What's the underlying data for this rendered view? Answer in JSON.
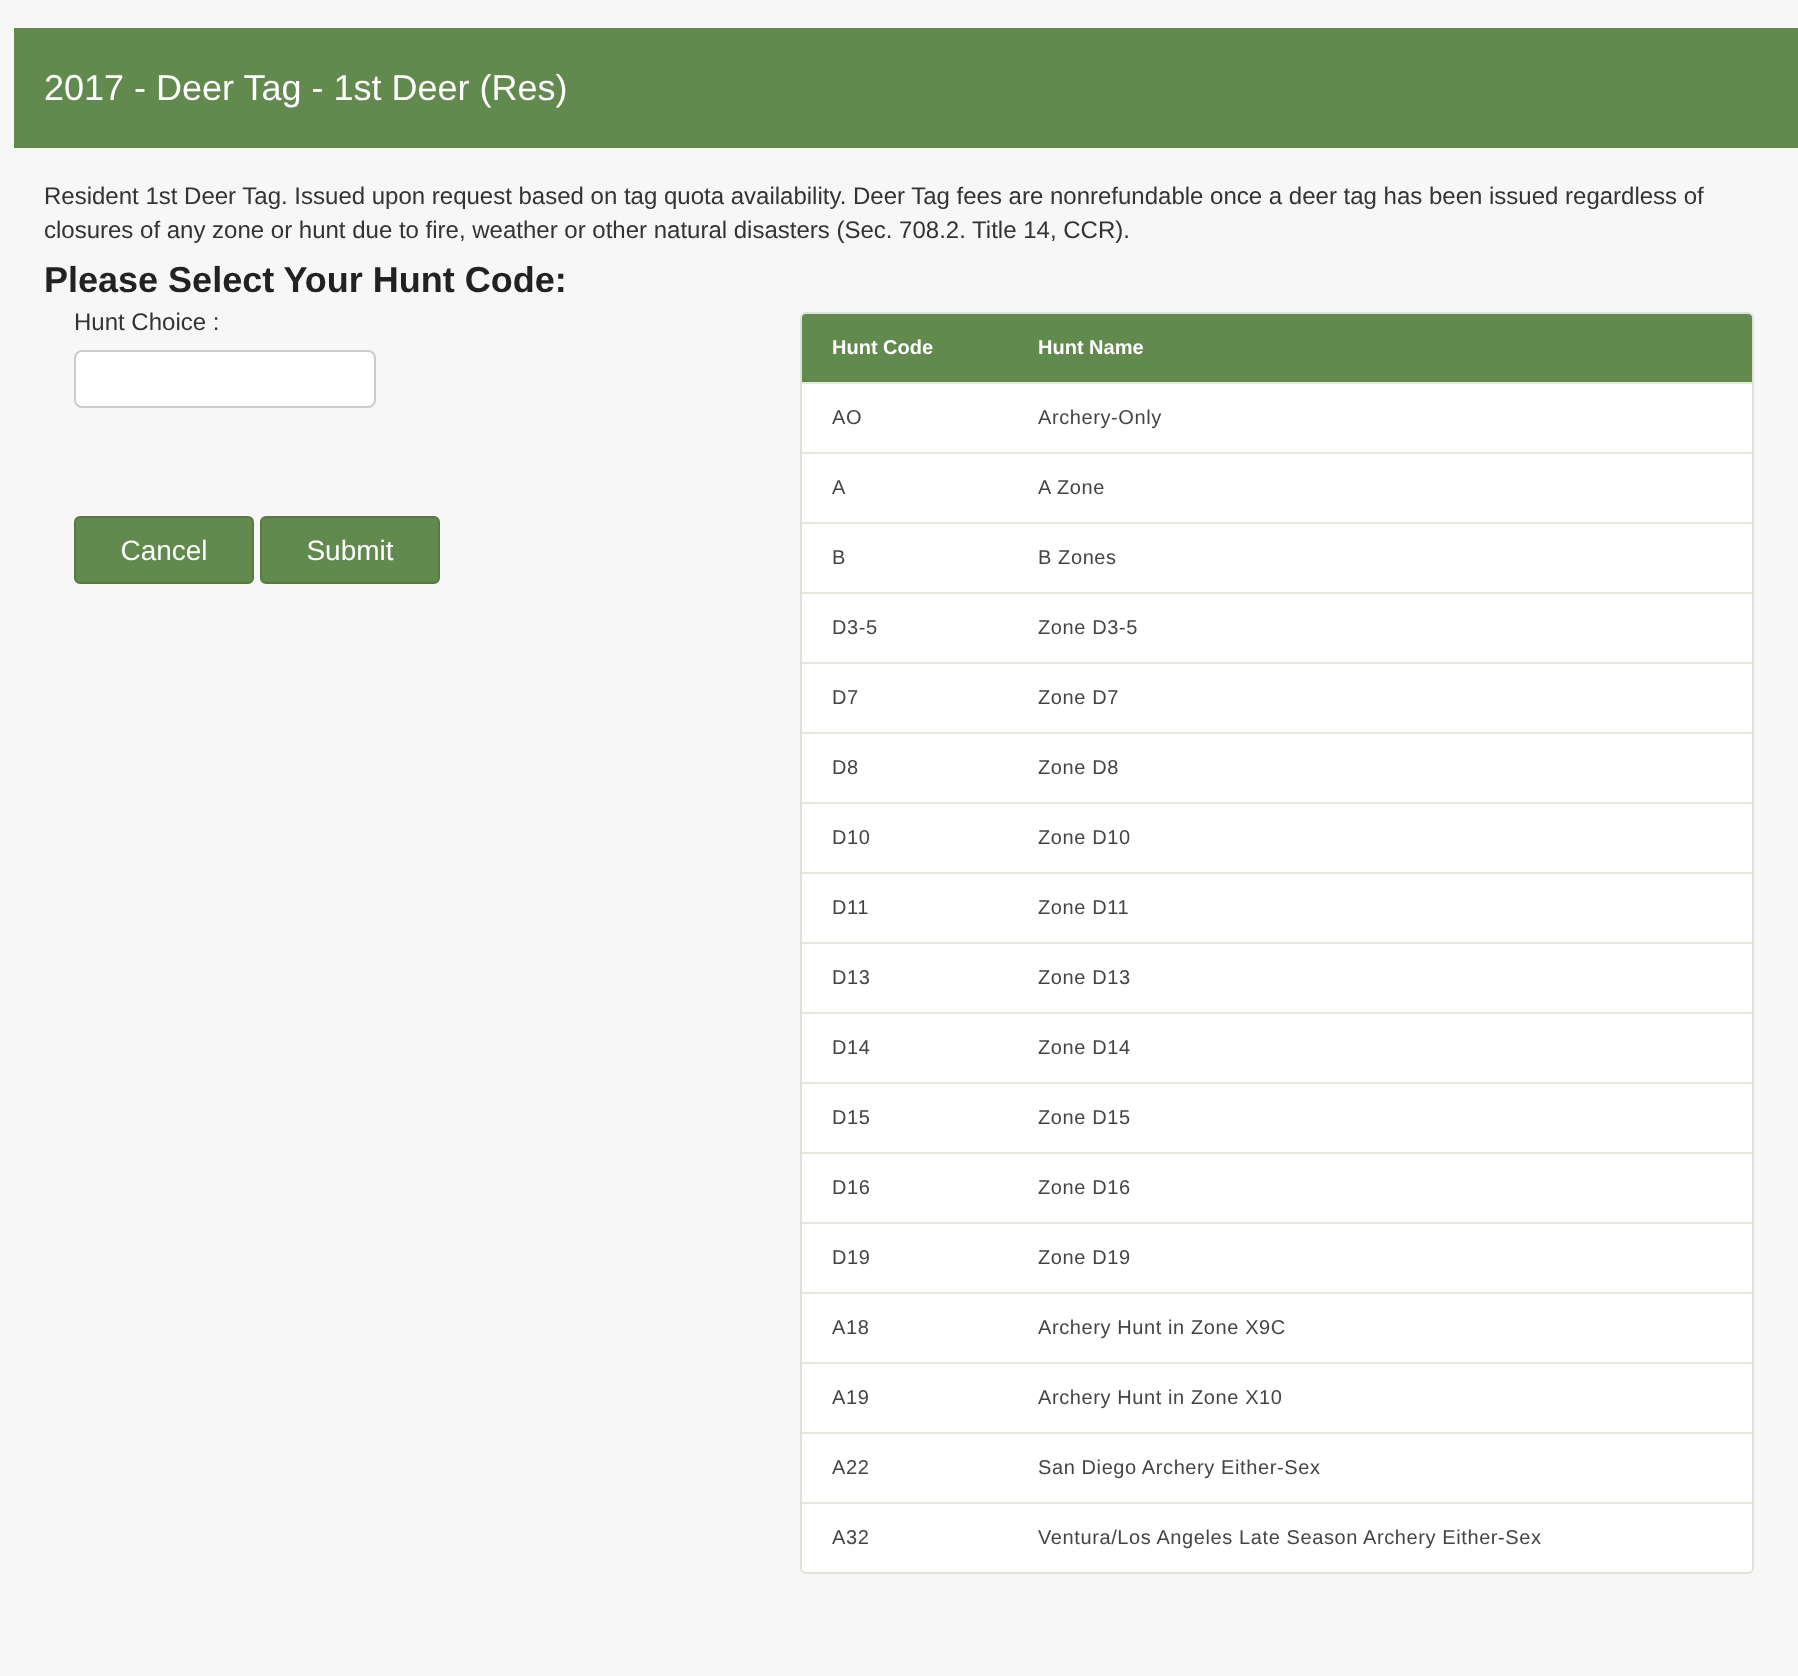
{
  "header": {
    "title": "2017 - Deer Tag - 1st Deer (Res)"
  },
  "description": "Resident 1st Deer Tag. Issued upon request based on tag quota availability. Deer Tag fees are nonrefundable once a deer tag has been issued regardless of closures of any zone or hunt due to fire, weather or other natural disasters (Sec. 708.2. Title 14, CCR).",
  "heading": "Please Select Your Hunt Code:",
  "field": {
    "label": "Hunt Choice :"
  },
  "buttons": [
    "Cancel",
    "Submit"
  ],
  "table": {
    "columns": [
      "Hunt Code",
      "Hunt Name"
    ],
    "rows": [
      [
        "AO",
        "Archery-Only"
      ],
      [
        "A",
        "A Zone"
      ],
      [
        "B",
        "B Zones"
      ],
      [
        "D3-5",
        "Zone D3-5"
      ],
      [
        "D7",
        "Zone D7"
      ],
      [
        "D8",
        "Zone D8"
      ],
      [
        "D10",
        "Zone D10"
      ],
      [
        "D11",
        "Zone D11"
      ],
      [
        "D13",
        "Zone D13"
      ],
      [
        "D14",
        "Zone D14"
      ],
      [
        "D15",
        "Zone D15"
      ],
      [
        "D16",
        "Zone D16"
      ],
      [
        "D19",
        "Zone D19"
      ],
      [
        "A18",
        "Archery Hunt in Zone X9C"
      ],
      [
        "A19",
        "Archery Hunt in Zone X10"
      ],
      [
        "A22",
        "San Diego Archery Either-Sex"
      ],
      [
        "A32",
        "Ventura/Los Angeles Late Season Archery Either-Sex"
      ]
    ]
  }
}
